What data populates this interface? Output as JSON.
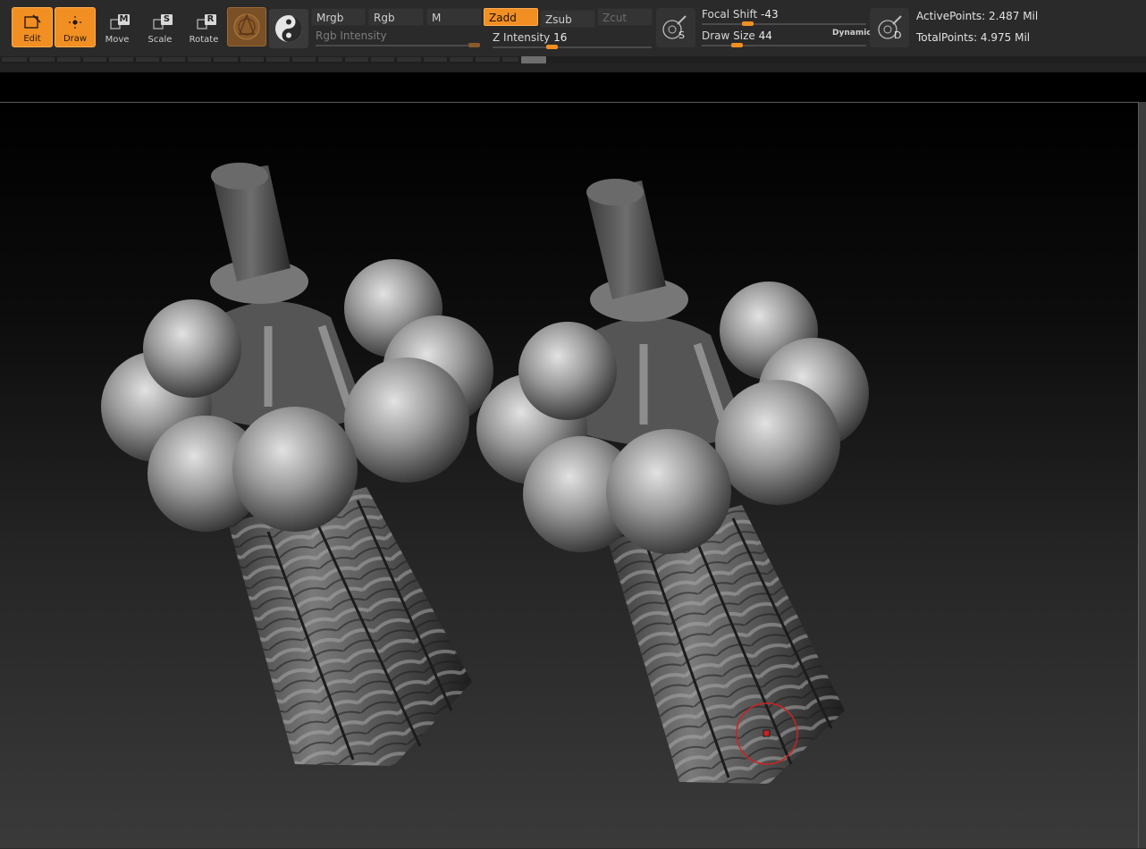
{
  "toolbar": {
    "tools": [
      {
        "label": "Edit",
        "active": true,
        "icon": "edit-icon"
      },
      {
        "label": "Draw",
        "active": true,
        "icon": "draw-icon",
        "badge": ""
      },
      {
        "label": "Move",
        "active": false,
        "icon": "move-icon",
        "badge": "M"
      },
      {
        "label": "Scale",
        "active": false,
        "icon": "scale-icon",
        "badge": "S"
      },
      {
        "label": "Rotate",
        "active": false,
        "icon": "rotate-icon",
        "badge": "R"
      }
    ],
    "material_icon": "material-sphere-icon",
    "stroke_icon": "stroke-icon",
    "modes": {
      "mrgb": "Mrgb",
      "rgb": "Rgb",
      "m": "M",
      "zadd": "Zadd",
      "zsub": "Zsub",
      "zcut": "Zcut"
    },
    "active_mode": "Zadd",
    "rgb_intensity": {
      "label": "Rgb Intensity",
      "value": 100,
      "max": 100
    },
    "z_intensity": {
      "label": "Z Intensity",
      "value": "16",
      "level": 0.16
    },
    "focal_shift": {
      "label": "Focal Shift",
      "value": "-43",
      "level": 0.28
    },
    "draw_size": {
      "label": "Draw Size",
      "value": "44",
      "level": 0.22,
      "dynamic": "Dynamic"
    },
    "lazy_brush_badge": "S",
    "dynamic_brush_badge": "D",
    "stats": {
      "active_points": "ActivePoints: 2.487 Mil",
      "total_points": "TotalPoints: 4.975 Mil"
    }
  },
  "viewport": {
    "model": "broccoli-sculpt",
    "model_count": 2,
    "brush_cursor": "red-circle"
  },
  "colors": {
    "accent": "#f28f22",
    "toolbar_bg": "#2a2a2a",
    "cursor": "#cc2222"
  }
}
